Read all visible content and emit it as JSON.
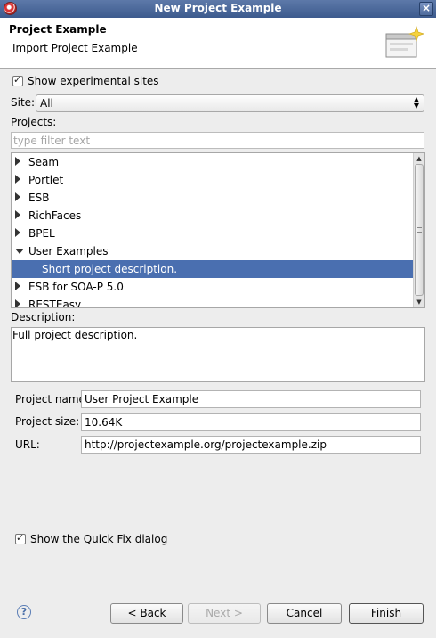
{
  "window": {
    "title": "New Project Example"
  },
  "banner": {
    "title": "Project Example",
    "subtitle": "Import Project Example"
  },
  "show_experimental": {
    "label": "Show experimental sites",
    "checked": true
  },
  "site": {
    "label": "Site:",
    "value": "All"
  },
  "projects": {
    "label": "Projects:",
    "filter_placeholder": "type filter text",
    "items": [
      {
        "label": "Seam",
        "state": "collapsed"
      },
      {
        "label": "Portlet",
        "state": "collapsed"
      },
      {
        "label": "ESB",
        "state": "collapsed"
      },
      {
        "label": "RichFaces",
        "state": "collapsed"
      },
      {
        "label": "BPEL",
        "state": "collapsed"
      },
      {
        "label": "User Examples",
        "state": "expanded"
      },
      {
        "label": "Short project description.",
        "state": "selected-child"
      },
      {
        "label": "ESB for SOA-P 5.0",
        "state": "collapsed"
      },
      {
        "label": "RESTEasy",
        "state": "collapsed"
      }
    ]
  },
  "description": {
    "label": "Description:",
    "text": "Full project description."
  },
  "details": {
    "name_label": "Project name:",
    "name_value": "User Project Example",
    "size_label": "Project size:",
    "size_value": "10.64K",
    "url_label": "URL:",
    "url_value": "http://projectexample.org/projectexample.zip"
  },
  "quick_fix": {
    "label": "Show the Quick Fix dialog",
    "checked": true
  },
  "buttons": {
    "back": "< Back",
    "next": "Next >",
    "cancel": "Cancel",
    "finish": "Finish"
  },
  "colors": {
    "selection": "#4a6fb0",
    "titlebar": "#4a6a9c"
  }
}
